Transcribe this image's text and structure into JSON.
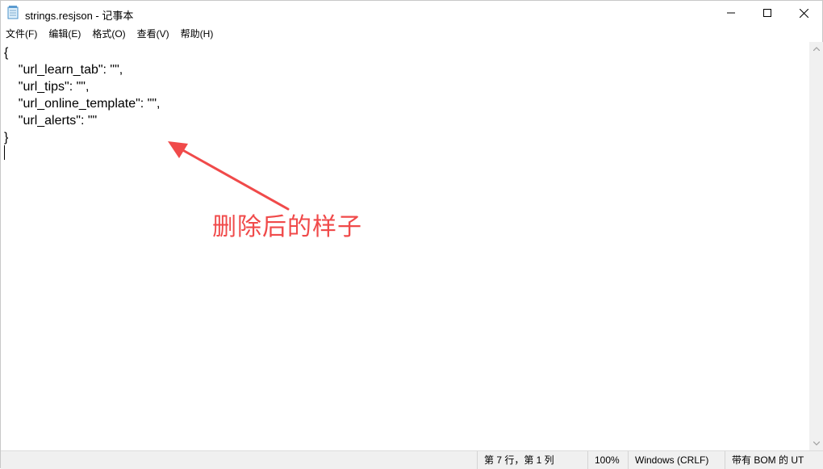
{
  "window": {
    "title": "strings.resjson - 记事本",
    "controls": {
      "minimize": "minimize-icon",
      "maximize": "maximize-icon",
      "close": "close-icon"
    }
  },
  "menu": [
    {
      "label": "文件(F)"
    },
    {
      "label": "编辑(E)"
    },
    {
      "label": "格式(O)"
    },
    {
      "label": "查看(V)"
    },
    {
      "label": "帮助(H)"
    }
  ],
  "editor": {
    "content": "{\n    \"url_learn_tab\": \"\",\n    \"url_tips\": \"\",\n    \"url_online_template\": \"\",\n    \"url_alerts\": \"\"\n}"
  },
  "annotation": {
    "text": "删除后的样子",
    "color": "#f04a4a"
  },
  "statusbar": {
    "position": "第 7 行，第 1 列",
    "zoom": "100%",
    "line_ending": "Windows (CRLF)",
    "encoding": "带有 BOM 的 UT"
  }
}
